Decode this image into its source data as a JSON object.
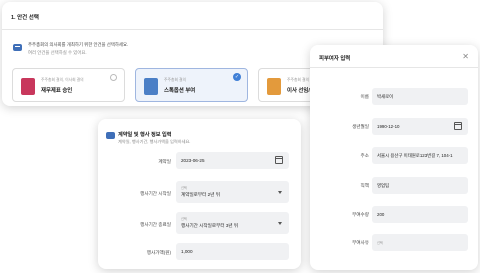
{
  "step_card": {
    "title": "1. 안건 선택",
    "info_line1": "주주총회의 의사회를 개최하기 위한 안건을 선택하세요.",
    "info_line2": "여러 안건을 선택하실 수 있어요.",
    "options": [
      {
        "small": "주주총회 결의, 이사회 결의",
        "label": "재무제표 승인",
        "selected": false,
        "icon": "approval-doc-icon"
      },
      {
        "small": "주주총회 결의",
        "label": "스톡옵션 부여",
        "selected": true,
        "icon": "stock-option-icon"
      },
      {
        "small": "주주총회 결의",
        "label": "이사 선임/중임",
        "selected": false,
        "icon": "director-icon"
      }
    ]
  },
  "contract_card": {
    "title": "계약일 및 행사 정보 입력",
    "subtitle": "계약일, 행사기간, 행사가액을 입력하세요.",
    "fields": {
      "contract_date": {
        "label": "계약일",
        "value": "2023-06-25"
      },
      "period_start": {
        "label": "행사기간 시작일",
        "caption": "선택",
        "value": "계약일로부터 2년 뒤"
      },
      "period_end": {
        "label": "행사기간 종료일",
        "caption": "선택",
        "value": "행사기간 시작일로부터 3년 뒤"
      },
      "price": {
        "label": "행사가액(원)",
        "value": "1,000"
      }
    }
  },
  "grantee_card": {
    "title": "피부여자 입력",
    "close_symbol": "✕",
    "fields": {
      "name": {
        "label": "이름",
        "value": "박새로이"
      },
      "birth": {
        "label": "생년월일",
        "value": "1990-12-10"
      },
      "address": {
        "label": "주소",
        "value": "서울시 용산구 이태원로123번길 7, 104-1"
      },
      "position": {
        "label": "직책",
        "value": "영업팀"
      },
      "quantity": {
        "label": "부여수량",
        "value": "200"
      },
      "reason": {
        "label": "부여사유",
        "caption": "선택",
        "value": ""
      }
    }
  }
}
